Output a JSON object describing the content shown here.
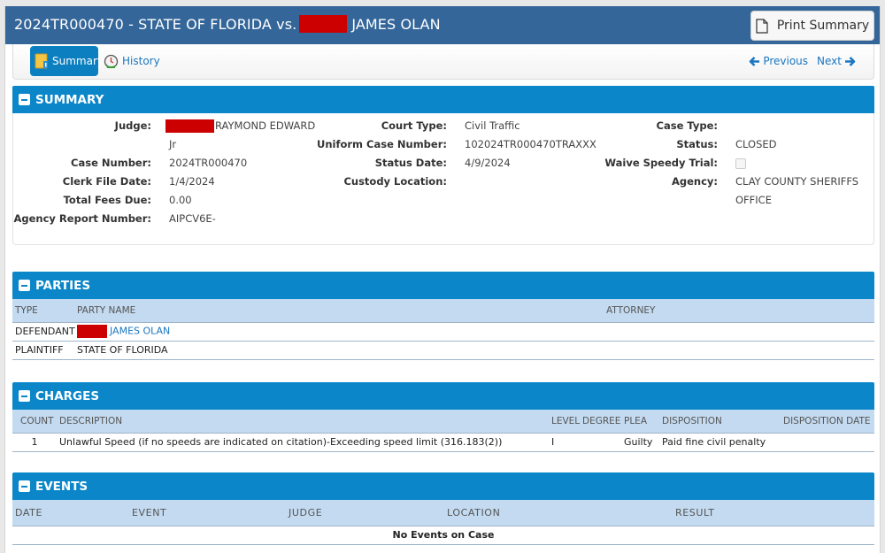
{
  "header": {
    "title_prefix": "2024TR000470 - STATE OF FLORIDA vs.",
    "title_suffix": "JAMES OLAN",
    "print_button": "Print Summary"
  },
  "nav": {
    "tabs": [
      {
        "label": "Summary",
        "icon": "summary-icon",
        "active": true
      },
      {
        "label": "History",
        "icon": "history-icon",
        "active": false
      }
    ],
    "previous": "Previous",
    "next": "Next"
  },
  "summary": {
    "title": "SUMMARY",
    "col1": [
      {
        "label": "Judge:",
        "value": "RAYMOND EDWARD",
        "value_line2": "Jr"
      },
      {
        "label": "Case Number:",
        "value": "2024TR000470"
      },
      {
        "label": "Clerk File Date:",
        "value": "1/4/2024"
      },
      {
        "label": "Total Fees Due:",
        "value": "0.00"
      },
      {
        "label": "Agency Report Number:",
        "value": "AIPCV6E-"
      }
    ],
    "col2": [
      {
        "label": "Court Type:",
        "value": "Civil Traffic"
      },
      {
        "label": "Uniform Case Number:",
        "value": "102024TR000470TRAXXX"
      },
      {
        "label": "Status Date:",
        "value": "4/9/2024"
      },
      {
        "label": "Custody Location:",
        "value": ""
      }
    ],
    "col3": [
      {
        "label": "Case Type:",
        "value": ""
      },
      {
        "label": "Status:",
        "value": "CLOSED"
      },
      {
        "label": "Waive Speedy Trial:",
        "checked": false
      },
      {
        "label": "Agency:",
        "value": "CLAY COUNTY SHERIFFS",
        "value_line2": "OFFICE"
      }
    ]
  },
  "parties": {
    "title": "PARTIES",
    "columns": [
      "TYPE",
      "PARTY NAME",
      "ATTORNEY"
    ],
    "rows": [
      {
        "type": "DEFENDANT",
        "name": "JAMES OLAN",
        "redacted": true,
        "attorney": ""
      },
      {
        "type": "PLAINTIFF",
        "name": "STATE OF FLORIDA",
        "redacted": false,
        "attorney": ""
      }
    ]
  },
  "charges": {
    "title": "CHARGES",
    "columns": [
      "COUNT",
      "DESCRIPTION",
      "LEVEL",
      "DEGREE",
      "PLEA",
      "DISPOSITION",
      "DISPOSITION DATE"
    ],
    "rows": [
      {
        "count": "1",
        "description": "Unlawful Speed (if no speeds are indicated on citation)-Exceeding speed limit (316.183(2))",
        "level": "I",
        "degree": "",
        "plea": "Guilty",
        "disposition": "Paid fine civil penalty",
        "disposition_date": ""
      }
    ]
  },
  "events": {
    "title": "EVENTS",
    "columns": [
      "DATE",
      "EVENT",
      "JUDGE",
      "LOCATION",
      "RESULT"
    ],
    "empty_message": "No Events on Case"
  }
}
